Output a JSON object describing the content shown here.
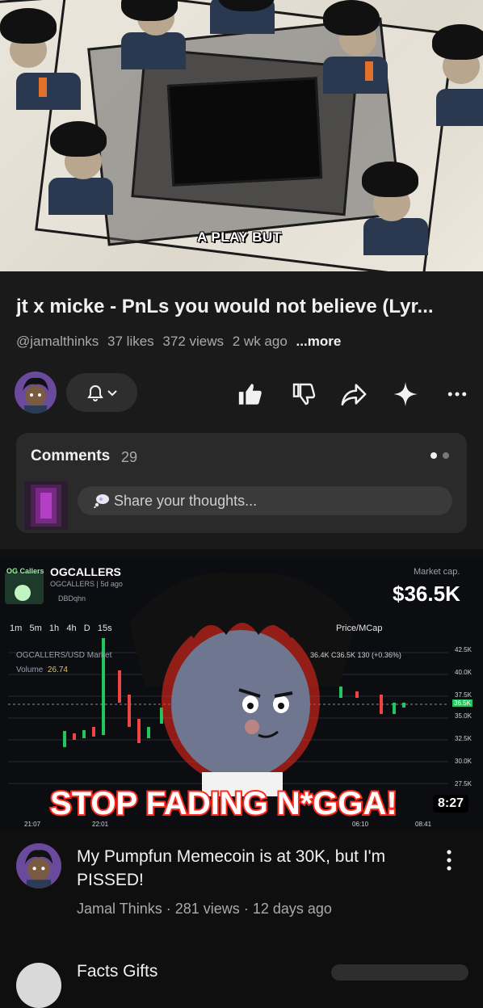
{
  "video": {
    "caption": "A PLAY BUT",
    "title": "jt x micke - PnLs you would not believe (Lyr...",
    "handle": "@jamalthinks",
    "likes": "37 likes",
    "views": "372 views",
    "age": "2 wk ago",
    "more_label": "...more"
  },
  "comments": {
    "title": "Comments",
    "count": "29",
    "placeholder": "Share your thoughts..."
  },
  "thumbnail": {
    "project_name": "OGCALLERS",
    "logo_text": "OG Callers",
    "subtitle": "OGCALLERS",
    "posted": "5d ago",
    "user": "DBDqhn",
    "market_cap_label": "Market cap.",
    "market_cap": "$36.5K",
    "timeframes": [
      "1m",
      "5m",
      "1h",
      "4h",
      "D",
      "15s"
    ],
    "pair": "OGCALLERS/USD Market",
    "volume_label": "Volume",
    "volume": "26.74",
    "price_toggle": "Price/MCap",
    "ohlc": "36.4K C36.5K 130 (+0.36%)",
    "y_ticks": [
      "42.5K",
      "40.0K",
      "37.5K",
      "36.5K",
      "35.0K",
      "32.5K",
      "30.0K",
      "27.5K"
    ],
    "x_ticks": [
      "21:07",
      "22:01",
      "06:10",
      "08:41"
    ],
    "overlay_text": "STOP FADING N*GGA!",
    "duration": "8:27",
    "accent": "#ff2a1e"
  },
  "recommended": {
    "title": "My Pumpfun Memecoin is at 30K, but I'm PISSED!",
    "channel": "Jamal Thinks",
    "views": "281 views",
    "age": "12 days ago",
    "separator": "·"
  },
  "next": {
    "title": "Facts Gifts"
  }
}
